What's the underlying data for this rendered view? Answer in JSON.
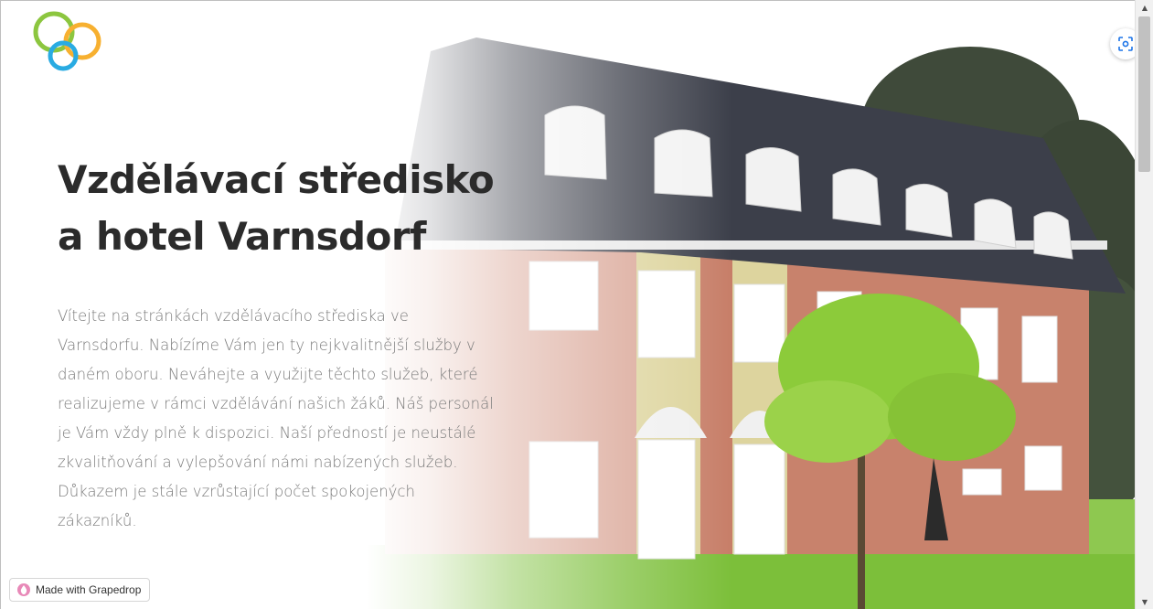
{
  "hero": {
    "title_line1": "Vzdělávací středisko",
    "title_line2": "a hotel Varnsdorf",
    "intro": "Vítejte na stránkách vzdělávacího střediska ve Varnsdorfu. Nabízíme Vám jen ty nejkvalitnější služby v daném oboru. Neváhejte a využijte těchto služeb, které realizujeme v rámci vzdělávání našich žáků. Náš personál je Vám vždy plně k dispozici. Naší předností je neustálé zkvalitňování a vylepšování námi nabízených služeb. Důkazem je stále vzrůstající počet spokojených zákazníků."
  },
  "logo": {
    "icon": "three-circles-logo",
    "colors": [
      "#8cc63f",
      "#f7b030",
      "#29abe2"
    ]
  },
  "badge": {
    "label": "Made with Grapedrop",
    "icon": "grapedrop-drop-icon",
    "color": "#e889b8"
  },
  "screenshot_button": {
    "icon": "screenshot-capture-icon",
    "color": "#1a73e8"
  },
  "scrollbar": {
    "up": "▲",
    "down": "▼"
  }
}
